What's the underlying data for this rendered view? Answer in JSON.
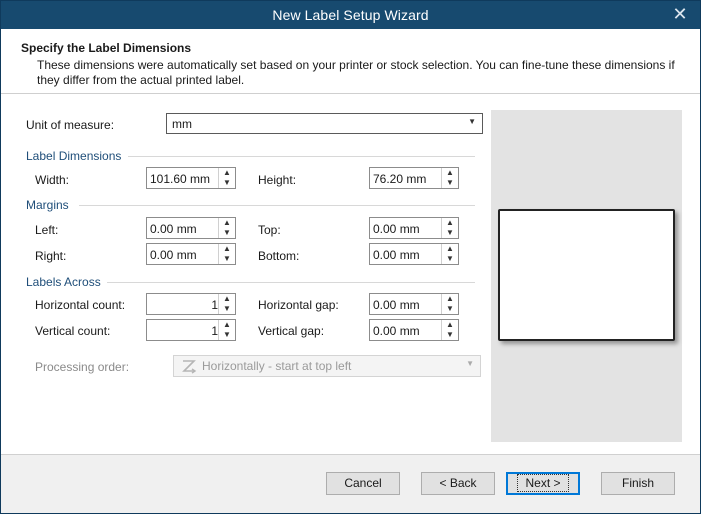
{
  "window": {
    "title": "New Label Setup Wizard",
    "close_glyph": "✕"
  },
  "header": {
    "title": "Specify the Label Dimensions",
    "description": "These dimensions were automatically set based on your printer or stock selection. You can fine-tune these dimensions if they differ from the actual printed label."
  },
  "unit": {
    "label": "Unit of measure:",
    "value": "mm"
  },
  "label_dimensions": {
    "title": "Label Dimensions",
    "width": {
      "label": "Width:",
      "value": "101.60 mm"
    },
    "height": {
      "label": "Height:",
      "value": "76.20 mm"
    }
  },
  "margins": {
    "title": "Margins",
    "left": {
      "label": "Left:",
      "value": "0.00 mm"
    },
    "top": {
      "label": "Top:",
      "value": "0.00 mm"
    },
    "right": {
      "label": "Right:",
      "value": "0.00 mm"
    },
    "bottom": {
      "label": "Bottom:",
      "value": "0.00 mm"
    }
  },
  "labels_across": {
    "title": "Labels Across",
    "horizontal_count": {
      "label": "Horizontal count:",
      "value": "1"
    },
    "horizontal_gap": {
      "label": "Horizontal gap:",
      "value": "0.00 mm"
    },
    "vertical_count": {
      "label": "Vertical count:",
      "value": "1"
    },
    "vertical_gap": {
      "label": "Vertical gap:",
      "value": "0.00 mm"
    }
  },
  "processing_order": {
    "label": "Processing order:",
    "value": "Horizontally - start at top left",
    "icon": "z-order-icon"
  },
  "spinner_glyphs": {
    "up": "▲",
    "down": "▼",
    "dropdown": "▼"
  },
  "buttons": {
    "cancel": "Cancel",
    "back": "< Back",
    "next": "Next >",
    "finish": "Finish"
  },
  "colors": {
    "titlebar": "#174a6f",
    "section_title": "#1f4e79",
    "default_button_border": "#0078d7"
  }
}
